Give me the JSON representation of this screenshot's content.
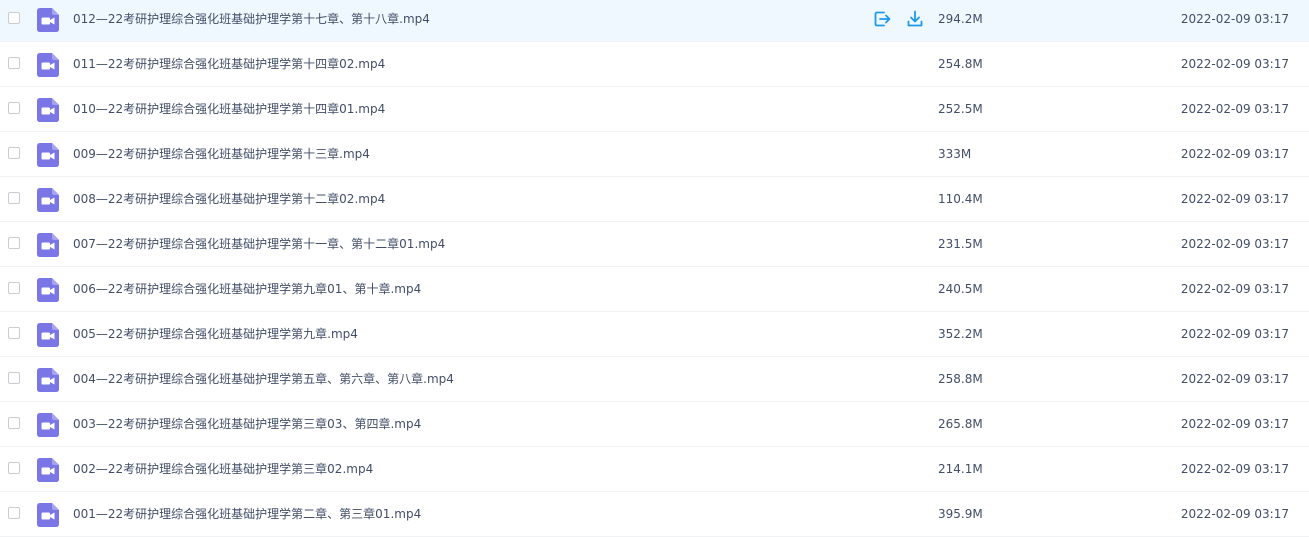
{
  "colors": {
    "video_icon": "#7a76e6",
    "action_icon": "#1b9aee",
    "text": "#424e67",
    "hover_row": "#f0f8ff"
  },
  "hover_actions": {
    "move_icon": "move-out-icon",
    "download_icon": "download-icon"
  },
  "files": [
    {
      "name": "012—22考研护理综合强化班基础护理学第十七章、第十八章.mp4",
      "size": "294.2M",
      "date": "2022-02-09 03:17",
      "hovered": true
    },
    {
      "name": "011—22考研护理综合强化班基础护理学第十四章02.mp4",
      "size": "254.8M",
      "date": "2022-02-09 03:17"
    },
    {
      "name": "010—22考研护理综合强化班基础护理学第十四章01.mp4",
      "size": "252.5M",
      "date": "2022-02-09 03:17"
    },
    {
      "name": "009—22考研护理综合强化班基础护理学第十三章.mp4",
      "size": "333M",
      "date": "2022-02-09 03:17"
    },
    {
      "name": "008—22考研护理综合强化班基础护理学第十二章02.mp4",
      "size": "110.4M",
      "date": "2022-02-09 03:17"
    },
    {
      "name": "007—22考研护理综合强化班基础护理学第十一章、第十二章01.mp4",
      "size": "231.5M",
      "date": "2022-02-09 03:17"
    },
    {
      "name": "006—22考研护理综合强化班基础护理学第九章01、第十章.mp4",
      "size": "240.5M",
      "date": "2022-02-09 03:17"
    },
    {
      "name": "005—22考研护理综合强化班基础护理学第九章.mp4",
      "size": "352.2M",
      "date": "2022-02-09 03:17"
    },
    {
      "name": "004—22考研护理综合强化班基础护理学第五章、第六章、第八章.mp4",
      "size": "258.8M",
      "date": "2022-02-09 03:17"
    },
    {
      "name": "003—22考研护理综合强化班基础护理学第三章03、第四章.mp4",
      "size": "265.8M",
      "date": "2022-02-09 03:17"
    },
    {
      "name": "002—22考研护理综合强化班基础护理学第三章02.mp4",
      "size": "214.1M",
      "date": "2022-02-09 03:17"
    },
    {
      "name": "001—22考研护理综合强化班基础护理学第二章、第三章01.mp4",
      "size": "395.9M",
      "date": "2022-02-09 03:17"
    }
  ]
}
